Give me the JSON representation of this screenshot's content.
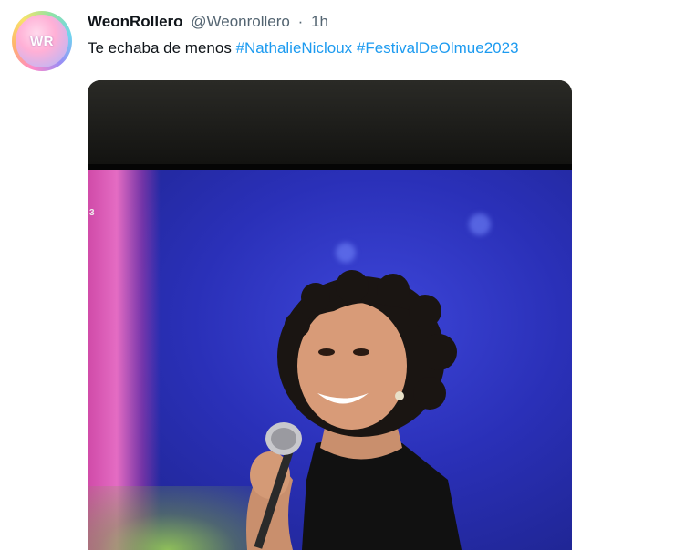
{
  "tweet": {
    "avatar_text": "WR",
    "display_name": "WeonRollero",
    "handle": "@Weonrollero",
    "separator": "·",
    "time": "1h",
    "text": "Te echaba de menos",
    "hashtags": [
      "#NathalieNicloux",
      "#FestivalDeOlmue2023"
    ]
  },
  "media": {
    "corner_mark": "3"
  },
  "colors": {
    "link": "#1d9bf0",
    "primary_text": "#0f1419",
    "secondary_text": "#536471"
  }
}
